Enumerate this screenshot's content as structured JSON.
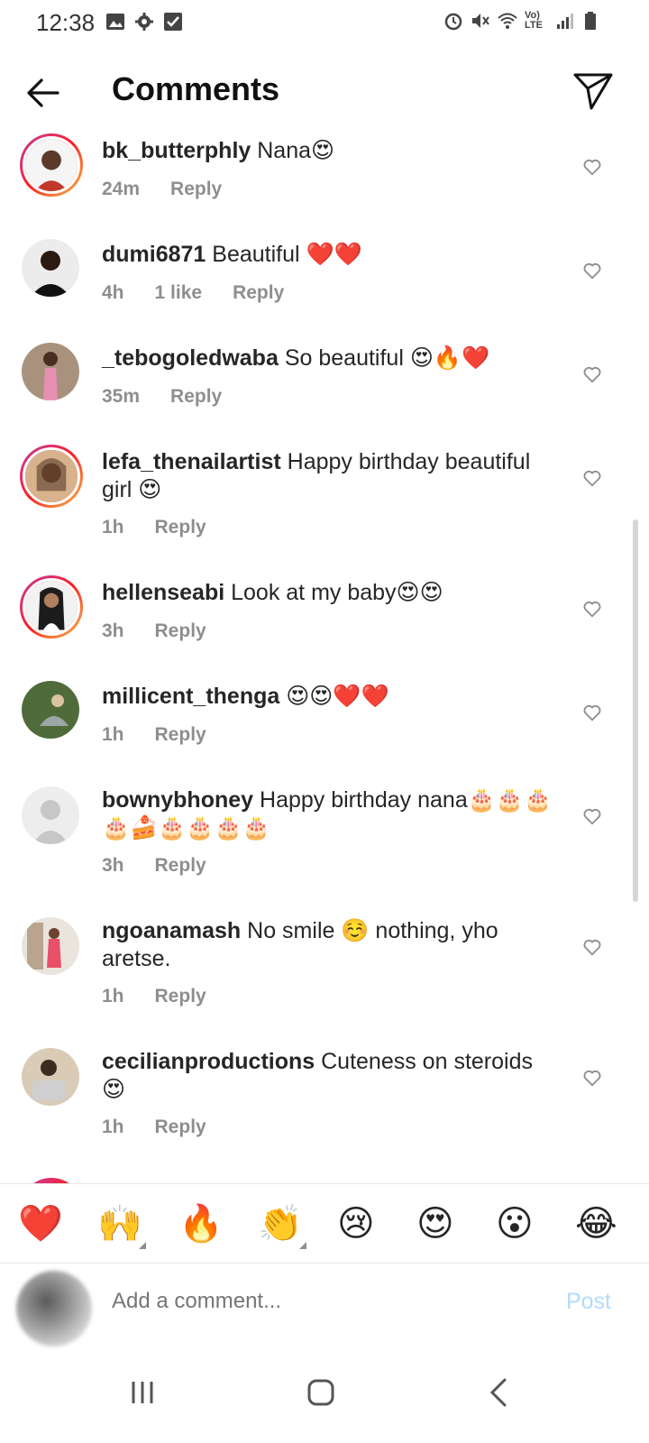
{
  "status": {
    "time": "12:38",
    "left_icons": [
      "image-icon",
      "gear-icon",
      "checkbox-icon"
    ],
    "right_icons": [
      "alarm-icon",
      "mute-icon",
      "wifi-icon",
      "volte-icon",
      "signal-icon",
      "battery-icon"
    ],
    "volte_label": "Vo) LTE"
  },
  "header": {
    "title": "Comments"
  },
  "comments": [
    {
      "username": "bk_butterphly",
      "text": "Nana😍",
      "time": "24m",
      "likes": "",
      "reply": "Reply"
    },
    {
      "username": "dumi6871",
      "text": "Beautiful ❤️❤️",
      "time": "4h",
      "likes": "1 like",
      "reply": "Reply"
    },
    {
      "username": "_tebogoledwaba",
      "text": "So beautiful 😍🔥❤️",
      "time": "35m",
      "likes": "",
      "reply": "Reply"
    },
    {
      "username": "lefa_thenailartist",
      "text": "Happy birthday beautiful girl 😍",
      "time": "1h",
      "likes": "",
      "reply": "Reply"
    },
    {
      "username": "hellenseabi",
      "text": "Look at my baby😍😍",
      "time": "3h",
      "likes": "",
      "reply": "Reply"
    },
    {
      "username": "millicent_thenga",
      "text": "😍😍❤️❤️",
      "time": "1h",
      "likes": "",
      "reply": "Reply"
    },
    {
      "username": "bownybhoney",
      "text": "Happy birthday nana🎂🎂🎂🎂🍰🎂🎂🎂🎂",
      "time": "3h",
      "likes": "",
      "reply": "Reply"
    },
    {
      "username": "ngoanamash",
      "text": "No smile ☺️ nothing, yho aretse.",
      "time": "1h",
      "likes": "",
      "reply": "Reply"
    },
    {
      "username": "cecilianproductions",
      "text": "Cuteness on steroids 😍",
      "time": "1h",
      "likes": "",
      "reply": "Reply"
    }
  ],
  "reactions": [
    "❤️",
    "🙌",
    "🔥",
    "👏",
    "😢",
    "😍",
    "😮",
    "😂"
  ],
  "composer": {
    "placeholder": "Add a comment...",
    "post_label": "Post"
  },
  "colors": {
    "post_disabled": "#b3dbff",
    "meta_gray": "#8e8e8e",
    "story_ring": "#e1306c"
  }
}
